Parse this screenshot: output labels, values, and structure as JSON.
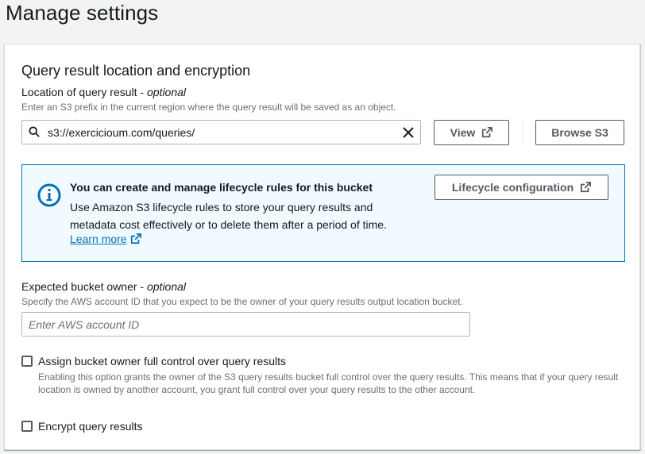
{
  "page": {
    "title": "Manage settings"
  },
  "section": {
    "title": "Query result location and encryption",
    "location": {
      "label": "Location of query result -",
      "optional": "optional",
      "description": "Enter an S3 prefix in the current region where the query result will be saved as an object.",
      "value": "s3://exercicioum.com/queries/",
      "icons": {
        "search": "search-icon",
        "clear": "close-icon"
      }
    },
    "buttons": {
      "view": "View",
      "browse": "Browse S3"
    },
    "info": {
      "title": "You can create and manage lifecycle rules for this bucket",
      "text": "Use Amazon S3 lifecycle rules to store your query results and metadata cost effectively or to delete them after a period of time.",
      "learn_more": "Learn more",
      "lifecycle_button": "Lifecycle configuration",
      "accent_color": "#0073bb",
      "background_color": "#f1faff"
    },
    "owner": {
      "label": "Expected bucket owner -",
      "optional": "optional",
      "description": "Specify the AWS account ID that you expect to be the owner of your query results output location bucket.",
      "placeholder": "Enter AWS account ID",
      "value": ""
    },
    "full_control": {
      "label": "Assign bucket owner full control over query results",
      "description": "Enabling this option grants the owner of the S3 query results bucket full control over the query results. This means that if your query result location is owned by another account, you grant full control over your query results to the other account.",
      "checked": false
    },
    "encrypt": {
      "label": "Encrypt query results",
      "checked": false
    }
  }
}
